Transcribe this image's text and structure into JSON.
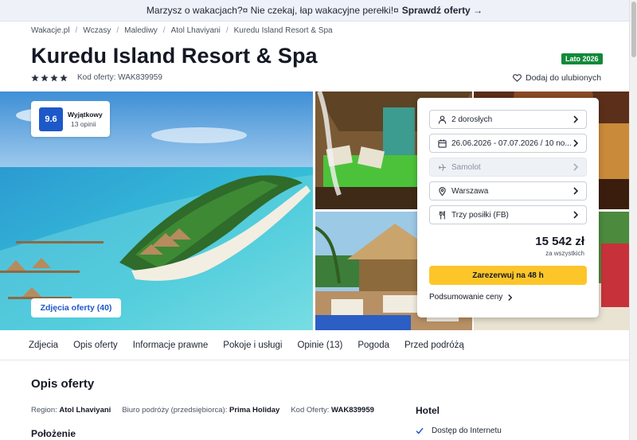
{
  "promo": {
    "text": "Marzysz o wakacjach?¤ Nie czekaj, łap wakacyjne perełki!¤",
    "cta": "Sprawdź oferty →"
  },
  "breadcrumb": [
    "Wakacje.pl",
    "Wczasy",
    "Malediwy",
    "Atol Lhaviyani",
    "Kuredu Island Resort & Spa"
  ],
  "hotel": {
    "name": "Kuredu Island Resort & Spa",
    "stars": 4,
    "offer_code_label": "Kod oferty: WAK839959",
    "season_badge": "Lato 2026",
    "favorite_label": "Dodaj do ulubionych"
  },
  "rating": {
    "score": "9.6",
    "label": "Wyjątkowy",
    "count": "13 opinii"
  },
  "gallery": {
    "photos_button": "Zdjęcia oferty (40)"
  },
  "booking": {
    "options": [
      {
        "icon": "person-icon",
        "label": "2 dorosłych",
        "disabled": false
      },
      {
        "icon": "calendar-icon",
        "label": "26.06.2026 - 07.07.2026 / 10 no...",
        "disabled": false
      },
      {
        "icon": "plane-icon",
        "label": "Samolot",
        "disabled": true
      },
      {
        "icon": "location-pin-icon",
        "label": "Warszawa",
        "disabled": false
      },
      {
        "icon": "cutlery-icon",
        "label": "Trzy posiłki (FB)",
        "disabled": false
      }
    ],
    "price": "15 542 zł",
    "price_note": "za wszystkich",
    "book_button": "Zarezerwuj na 48 h",
    "summary_link": "Podsumowanie ceny"
  },
  "tabs": [
    "Zdjecia",
    "Opis oferty",
    "Informacje prawne",
    "Pokoje i usługi",
    "Opinie (13)",
    "Pogoda",
    "Przed podróżą"
  ],
  "description": {
    "title": "Opis oferty",
    "region_label": "Region:",
    "region_value": "Atol Lhaviyani",
    "agency_label": "Biuro podróży (przedsiębiorca):",
    "agency_value": "Prima Holiday",
    "code_label": "Kod Oferty:",
    "code_value": "WAK839959",
    "location_title": "Położenie"
  },
  "hotel_section": {
    "title": "Hotel",
    "amenities": [
      "Dostęp do Internetu"
    ]
  },
  "colors": {
    "brand_blue": "#1d58c9",
    "cta_yellow": "#fcc62a",
    "badge_green": "#12893a",
    "star": "#2b3140"
  }
}
